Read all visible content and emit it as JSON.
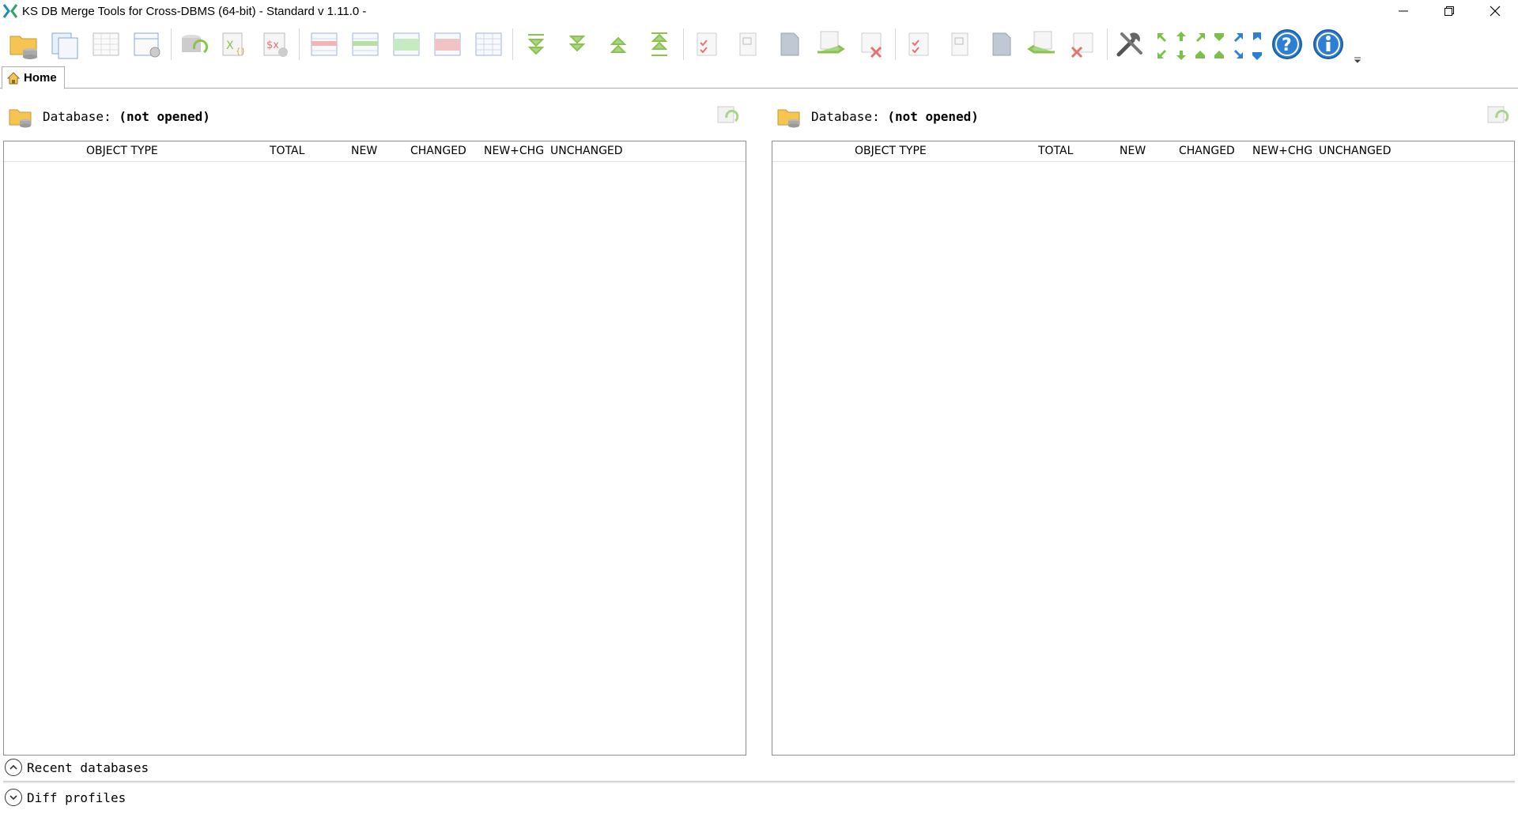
{
  "window": {
    "title": "KS DB Merge Tools for Cross-DBMS (64-bit) - Standard v 1.11.0 -",
    "minimize_glyph": "—",
    "close_glyph": "✕"
  },
  "tabs": [
    {
      "label": "Home",
      "icon": "home-icon"
    }
  ],
  "left_panel": {
    "db_prefix": "Database:",
    "db_name": "(not opened)",
    "columns": [
      "OBJECT TYPE",
      "TOTAL",
      "NEW",
      "CHANGED",
      "NEW+CHG",
      "UNCHANGED"
    ]
  },
  "right_panel": {
    "db_prefix": "Database:",
    "db_name": "(not opened)",
    "columns": [
      "OBJECT TYPE",
      "TOTAL",
      "NEW",
      "CHANGED",
      "NEW+CHG",
      "UNCHANGED"
    ]
  },
  "bottom": {
    "recent_label": "Recent databases",
    "diff_label": "Diff profiles"
  },
  "colors": {
    "accent_blue": "#2d7fd4",
    "toolbar_green": "#8bc34a",
    "toolbar_red": "#e57373"
  }
}
